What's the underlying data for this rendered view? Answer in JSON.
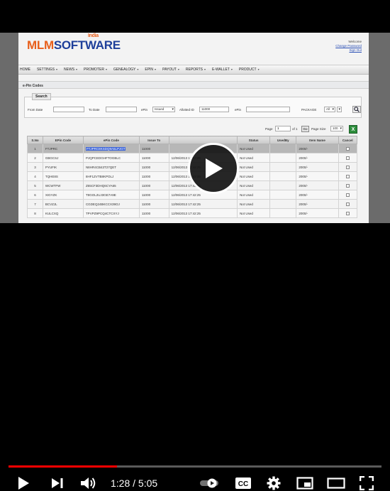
{
  "app": {
    "brand_mlm": "MLM",
    "brand_software": "SOFTWARE",
    "brand_india": "India",
    "welcome": "Welcome",
    "change_password": "Change Password",
    "sign_out": "Sign Out"
  },
  "nav": [
    "HOME",
    "SETTINGS",
    "NEWS",
    "PROMOTER",
    "GENEALOGY",
    "EPIN",
    "PAYOUT",
    "REPORTS",
    "E-WALLET",
    "PRODUCT"
  ],
  "page_title": "e-Pin Codes",
  "search": {
    "legend": "Search",
    "from_date_label": "From Date",
    "to_date_label": "To Date",
    "epin_label": "ePin",
    "epin_status": "Issued",
    "allotted_label": "Allotted ID",
    "allotted_value": "11000",
    "epin2_label": "ePin",
    "package_label": "PACKAGE",
    "package_value": "All"
  },
  "pager": {
    "page_label": "Page",
    "page_value": "1",
    "of_label": "of 1",
    "go_label": "Go",
    "page_size_label": "Page Size",
    "page_size_value": "100"
  },
  "table": {
    "headers": [
      "S.No",
      "EPin Code",
      "ePin Code",
      "Issue To",
      "",
      "Status",
      "UsedBy",
      "Item Name",
      "Cancel"
    ],
    "rows": [
      {
        "sno": "1",
        "code": "FTJPRC",
        "epin": "FTJPRC8KSDQ9A5LPJGT",
        "issue": "11000",
        "date": "",
        "status": "Not Used",
        "used": "",
        "item": "2000/-"
      },
      {
        "sno": "2",
        "code": "GBGCSJ",
        "epin": "PJQPCEDGHFTOGBLC",
        "issue": "11000",
        "date": "12/06/2013 17:42:25",
        "status": "Not Used",
        "used": "",
        "item": "2000/-"
      },
      {
        "sno": "3",
        "code": "PYUFIK",
        "epin": "N8HR4CB43T27QET",
        "issue": "11000",
        "date": "12/06/2013 17:42:25",
        "status": "Not Used",
        "used": "",
        "item": "2000/-"
      },
      {
        "sno": "4",
        "code": "TQHE8S",
        "epin": "8HF1ZVTB8KPOLJ",
        "issue": "11000",
        "date": "12/06/2013 17:42:25",
        "status": "Not Used",
        "used": "",
        "item": "2000/-"
      },
      {
        "sno": "5",
        "code": "WCWTFW",
        "epin": "Z65CF3DHQ6CYA65",
        "issue": "11000",
        "date": "12/06/2013 17:42:25",
        "status": "Not Used",
        "used": "",
        "item": "2000/-"
      },
      {
        "sno": "6",
        "code": "XIGYZK",
        "epin": "T8GOL2UJ3GE7A9E",
        "issue": "11000",
        "date": "12/06/2013 17:42:25",
        "status": "Not Used",
        "used": "",
        "item": "2000/-"
      },
      {
        "sno": "7",
        "code": "BCVZJL",
        "epin": "CGDEQ24BKCCX39OJ",
        "issue": "11000",
        "date": "12/06/2013 17:42:25",
        "status": "Not Used",
        "used": "",
        "item": "2000/-"
      },
      {
        "sno": "8",
        "code": "KULCXQ",
        "epin": "TPVPZ9PCQ4CTCXYJ",
        "issue": "11000",
        "date": "12/06/2013 17:42:25",
        "status": "Not Used",
        "used": "",
        "item": "2000/-"
      }
    ]
  },
  "player": {
    "time_current": "1:28",
    "time_sep": " / ",
    "time_total": "5:05",
    "progress": 0.29,
    "accent": "#ff0000"
  },
  "icons": [
    "play-icon",
    "next-icon",
    "volume-icon",
    "autoplay-toggle-icon",
    "captions-icon",
    "settings-icon",
    "miniplayer-icon",
    "theater-icon",
    "fullscreen-icon",
    "excel-export-icon",
    "search-icon"
  ]
}
